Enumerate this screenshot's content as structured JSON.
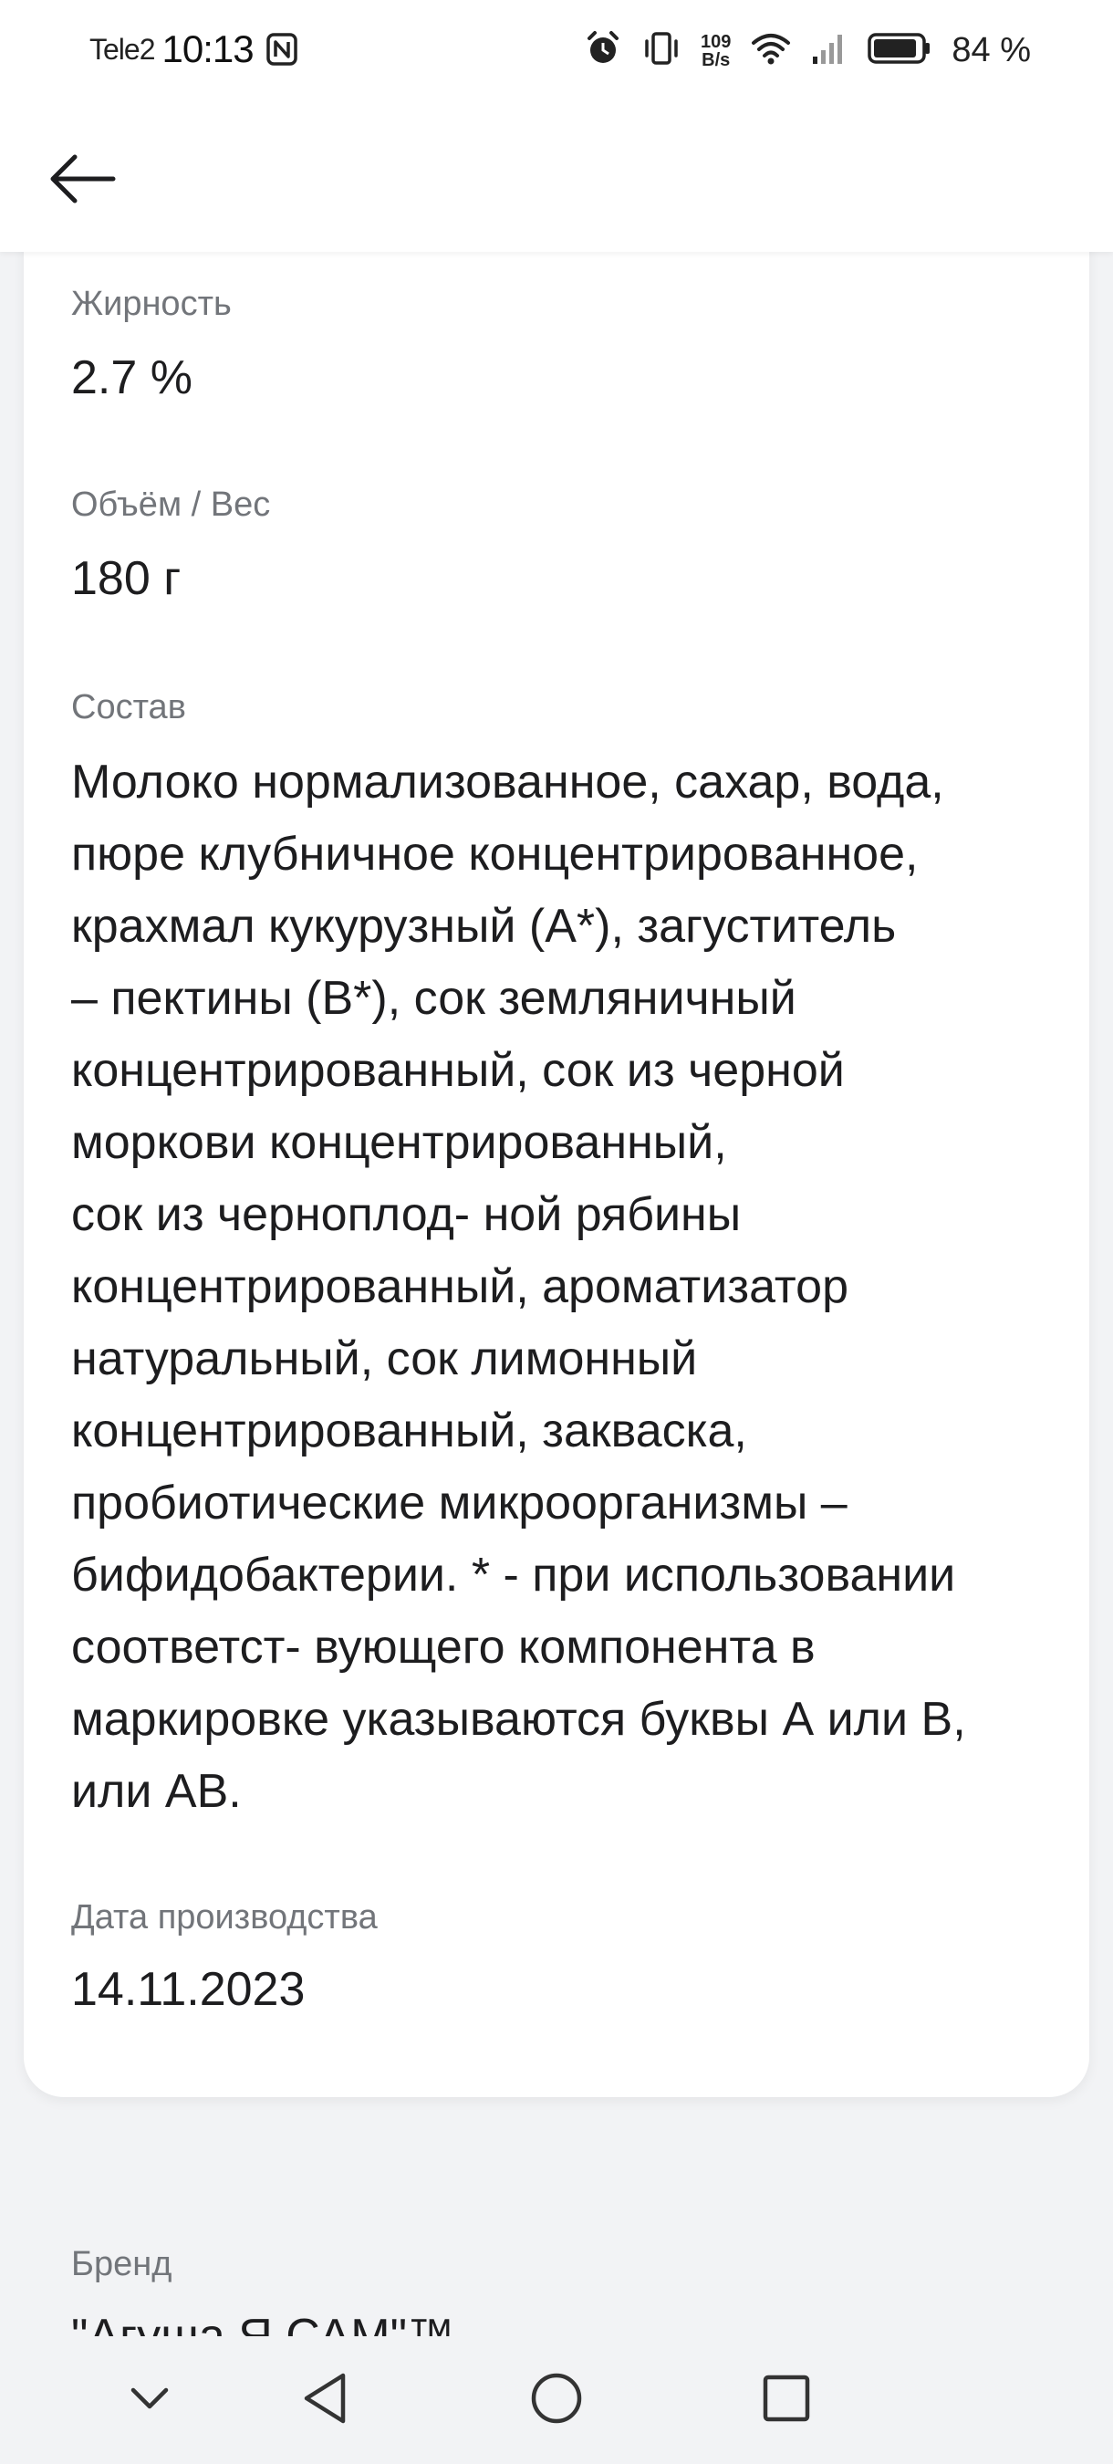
{
  "status_bar": {
    "carrier": "Tele2",
    "time": "10:13",
    "net_speed_value": "109",
    "net_speed_unit": "B/s",
    "battery": "84 %",
    "icons": [
      "nfc-icon",
      "alarm-icon",
      "vibrate-icon",
      "wifi-icon",
      "signal-icon",
      "battery-icon"
    ]
  },
  "header": {
    "back_icon": "arrow-left-icon"
  },
  "product": {
    "fat_label": "Жирность",
    "fat_value": "2.7 %",
    "volume_label": "Объём / Вес",
    "volume_value": "180 г",
    "composition_label": "Состав",
    "composition_lines": [
      "Молоко нормализованное, сахар, вода,",
      "пюре клубничное концентрированное,",
      "крахмал кукурузный (А*), загуститель",
      "– пектины (В*), сок земляничный",
      "концентрированный, сок из черной",
      "моркови концентрированный,",
      "сок из черноплод- ной рябины",
      "концентрированный, ароматизатор",
      "натуральный, сок лимонный",
      "концентрированный, закваска,",
      "пробиотические микроорганизмы –",
      "бифидобактерии. * - при использовании",
      "соответст- вующего компонента в",
      "маркировке указываются буквы А или В,",
      "или АВ."
    ],
    "production_date_label": "Дата производства",
    "production_date_value": "14.11.2023",
    "brand_label": "Бренд",
    "brand_value": "\"Агуша Я САМ\"™"
  },
  "nav_bar": {
    "icons": [
      "chevron-down-icon",
      "back-triangle-icon",
      "home-circle-icon",
      "recents-square-icon"
    ]
  },
  "colors": {
    "background": "#f2f3f5",
    "card": "#ffffff",
    "label": "#72757a",
    "text": "#1d1d1f"
  }
}
